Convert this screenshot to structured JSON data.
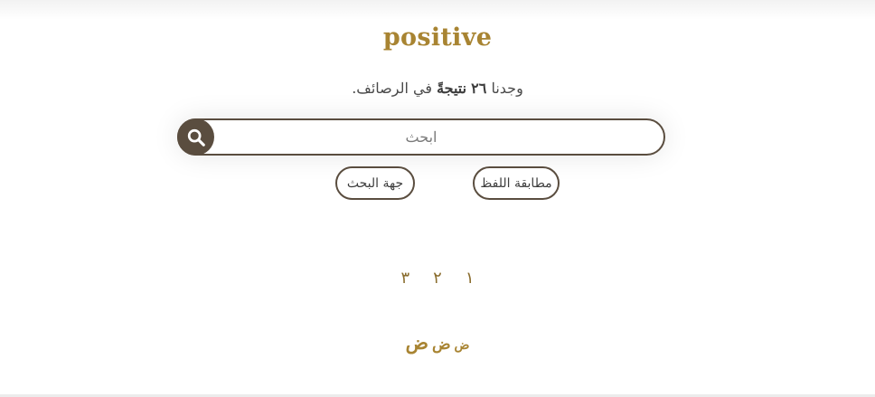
{
  "header": {
    "title": "positive"
  },
  "summary": {
    "prefix": "وجدنا",
    "count": "٢٦",
    "unit": "نتيجةً",
    "suffix": "في الرصائف."
  },
  "search": {
    "placeholder": "ابحث",
    "value": "",
    "button_icon": "search-icon"
  },
  "filters": {
    "match_label": "مطابقة اللفظ",
    "direction_label": "جهة البحث"
  },
  "pagination": {
    "pages": [
      "١",
      "٢",
      "٣"
    ]
  },
  "font_size_controls": {
    "small": "ض",
    "medium": "ض",
    "large": "ض"
  },
  "colors": {
    "accent": "#a88432",
    "dark": "#5a4d3f"
  }
}
